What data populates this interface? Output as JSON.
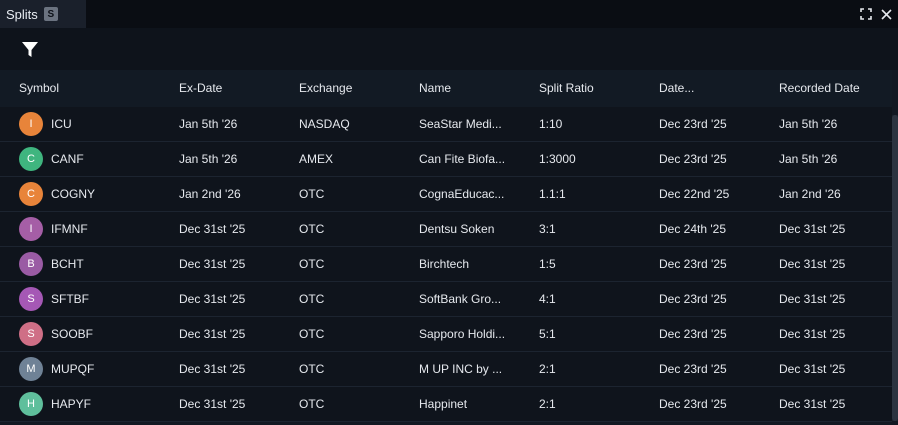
{
  "tab": {
    "title": "Splits",
    "badge": "S"
  },
  "window_controls": {
    "maximize": "maximize-icon",
    "close": "close-icon"
  },
  "toolbar": {
    "filter_icon": "filter-icon"
  },
  "columns": [
    "Symbol",
    "Ex-Date",
    "Exchange",
    "Name",
    "Split Ratio",
    "Date...",
    "Recorded Date"
  ],
  "rows": [
    {
      "initial": "I",
      "avatar_color": "#e8843a",
      "symbol": "ICU",
      "ex_date": "Jan 5th '26",
      "exchange": "NASDAQ",
      "name": "SeaStar Medi...",
      "ratio": "1:10",
      "date": "Dec 23rd '25",
      "recorded": "Jan 5th '26"
    },
    {
      "initial": "C",
      "avatar_color": "#3fb57f",
      "symbol": "CANF",
      "ex_date": "Jan 5th '26",
      "exchange": "AMEX",
      "name": "Can Fite Biofa...",
      "ratio": "1:3000",
      "date": "Dec 23rd '25",
      "recorded": "Jan 5th '26"
    },
    {
      "initial": "C",
      "avatar_color": "#e8843a",
      "symbol": "COGNY",
      "ex_date": "Jan 2nd '26",
      "exchange": "OTC",
      "name": "CognaEducac...",
      "ratio": "1.1:1",
      "date": "Dec 22nd '25",
      "recorded": "Jan 2nd '26"
    },
    {
      "initial": "I",
      "avatar_color": "#a55ea6",
      "symbol": "IFMNF",
      "ex_date": "Dec 31st '25",
      "exchange": "OTC",
      "name": "Dentsu Soken",
      "ratio": "3:1",
      "date": "Dec 24th '25",
      "recorded": "Dec 31st '25"
    },
    {
      "initial": "B",
      "avatar_color": "#9a5ba4",
      "symbol": "BCHT",
      "ex_date": "Dec 31st '25",
      "exchange": "OTC",
      "name": "Birchtech",
      "ratio": "1:5",
      "date": "Dec 23rd '25",
      "recorded": "Dec 31st '25"
    },
    {
      "initial": "S",
      "avatar_color": "#a558b5",
      "symbol": "SFTBF",
      "ex_date": "Dec 31st '25",
      "exchange": "OTC",
      "name": "SoftBank Gro...",
      "ratio": "4:1",
      "date": "Dec 23rd '25",
      "recorded": "Dec 31st '25"
    },
    {
      "initial": "S",
      "avatar_color": "#cf6f86",
      "symbol": "SOOBF",
      "ex_date": "Dec 31st '25",
      "exchange": "OTC",
      "name": "Sapporo Holdi...",
      "ratio": "5:1",
      "date": "Dec 23rd '25",
      "recorded": "Dec 31st '25"
    },
    {
      "initial": "M",
      "avatar_color": "#6f8296",
      "symbol": "MUPQF",
      "ex_date": "Dec 31st '25",
      "exchange": "OTC",
      "name": "M UP INC by ...",
      "ratio": "2:1",
      "date": "Dec 23rd '25",
      "recorded": "Dec 31st '25"
    },
    {
      "initial": "H",
      "avatar_color": "#5fbf9c",
      "symbol": "HAPYF",
      "ex_date": "Dec 31st '25",
      "exchange": "OTC",
      "name": "Happinet",
      "ratio": "2:1",
      "date": "Dec 23rd '25",
      "recorded": "Dec 31st '25"
    }
  ]
}
